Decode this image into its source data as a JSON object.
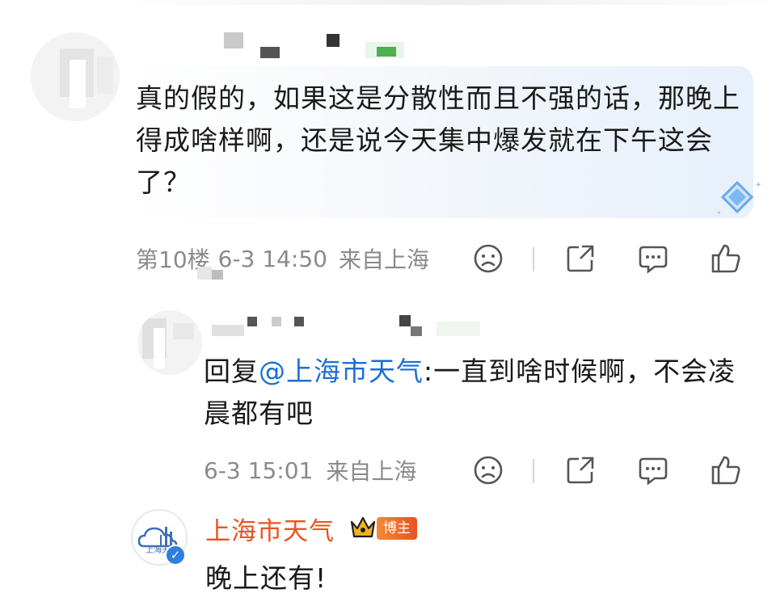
{
  "main_comment": {
    "text": "真的假的，如果这是分散性而且不强的话，那晚上得成啥样啊，还是说今天集中爆发就在下午这会了？",
    "floor": "第10楼",
    "date_time": "6-3 14:50",
    "location": "来自上海"
  },
  "reply": {
    "prefix": "回复",
    "mention": "@上海市天气",
    "text": ":一直到啥时候啊，不会凌晨都有吧",
    "date_time": "6-3 15:01",
    "location": "来自上海"
  },
  "author_reply": {
    "name": "上海市天气",
    "badge": "博主",
    "avatar_text": "上海天气",
    "text": "晚上还有!"
  },
  "colors": {
    "author_name": "#e9531f",
    "mention": "#1b6fd3",
    "meta": "#8a8a8a"
  },
  "icons": [
    "sad-face-icon",
    "share-icon",
    "comment-icon",
    "like-icon",
    "diamond-badge-icon",
    "crown-icon",
    "verified-icon"
  ]
}
